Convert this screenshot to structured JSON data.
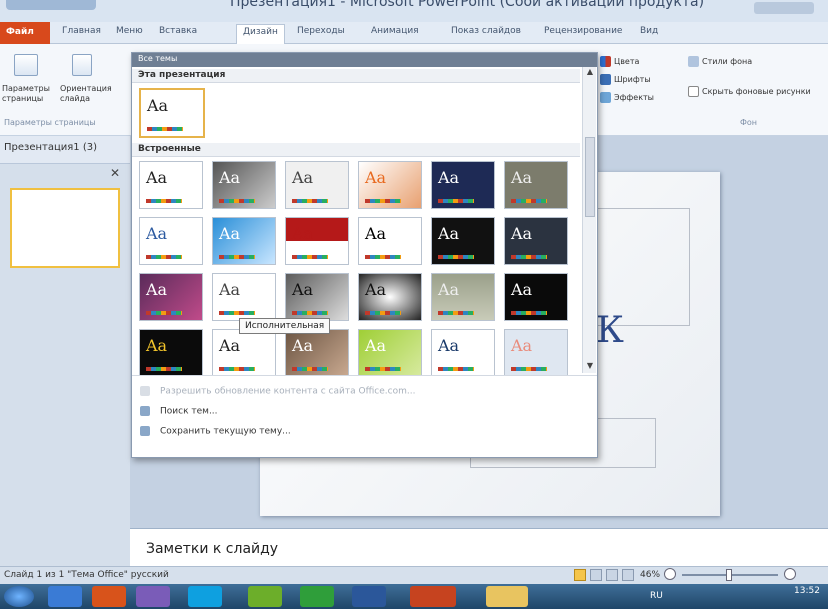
{
  "window": {
    "title": "Презентация1 - Microsoft PowerPoint (Сбой активации продукта)"
  },
  "ribbon_tabs": [
    "Файл",
    "Главная",
    "Меню",
    "Вставка",
    "Дизайн",
    "Переходы",
    "Анимация",
    "Показ слайдов",
    "Рецензирование",
    "Вид"
  ],
  "ribbon": {
    "btn1_label": "Параметры страницы",
    "btn2_label": "Ориентация слайда",
    "group_page": "Параметры страницы",
    "colors": "Цвета",
    "fonts": "Шрифты",
    "effects": "Эффекты",
    "bg_styles": "Стили фона",
    "hide_bg": "Скрыть фоновые рисунки",
    "group_bg": "Фон"
  },
  "left_panel": {
    "tab_label": "Презентация1 (3)"
  },
  "dropdown": {
    "header": "Все темы",
    "this_pres": "Эта презентация",
    "builtin": "Встроенные",
    "tooltip": "Исполнительная",
    "footer": {
      "update": "Разрешить обновление контента с сайта Office.com...",
      "search": "Поиск тем...",
      "save": "Сохранить текущую тему..."
    },
    "aa_label": "Aa"
  },
  "slide_char": "К",
  "notes": {
    "label": "Заметки к слайду"
  },
  "status": {
    "text": "Слайд 1 из 1   \"Тема Office\"   русский"
  },
  "zoom": {
    "text": "46%"
  },
  "clock": {
    "time": "13:52"
  },
  "lang": {
    "code": "RU"
  }
}
